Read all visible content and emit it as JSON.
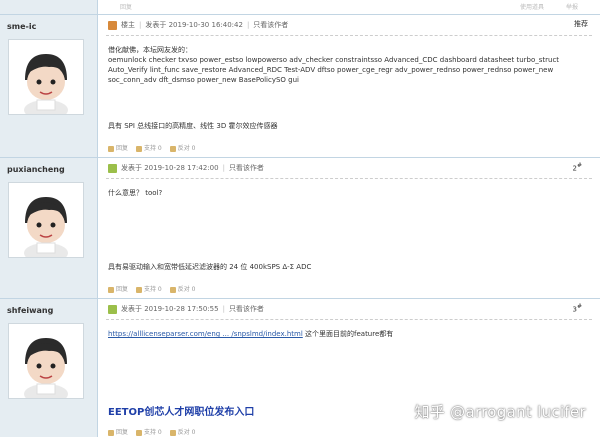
{
  "top_strip": {
    "left_action": "回复",
    "right_actions": [
      "使用道具",
      "举报"
    ]
  },
  "posts": [
    {
      "username": "sme-ic",
      "badge": "楼主",
      "posted": "发表于 2019-10-30 16:40:42",
      "author_only": "只看该作者",
      "floor_label": "推荐",
      "lines": [
        "借化献佛，本坛网友发的：",
        "oemunlock checker txvso power_estso lowpowerso adv_checker constraintsso Advanced_CDC dashboard datasheet turbo_struct",
        "Auto_Verify lint_func save_restore Advanced_RDC Test-ADV dftso power_cge_regr adv_power_rednso    power_rednso power_new",
        "soc_conn_adv dft_dsmso power_new BasePolicySO gui"
      ],
      "signature": "具有 SPI 总线接口的高精度、线性 3D 霍尔效应传感器",
      "actions": [
        "回复",
        "支持 0",
        "反对 0"
      ]
    },
    {
      "username": "puxiancheng",
      "posted": "发表于 2019-10-28 17:42:00",
      "author_only": "只看该作者",
      "floor_num": "2",
      "floor_sup": "#",
      "lines": [
        "什么意思？ tool?"
      ],
      "signature": "具有易驱动输入和宽带低延迟滤波器的 24 位 400kSPS Δ-Σ ADC",
      "actions": [
        "回复",
        "支持 0",
        "反对 0"
      ]
    },
    {
      "username": "shfeiwang",
      "posted": "发表于 2019-10-28 17:50:55",
      "author_only": "只看该作者",
      "floor_num": "3",
      "floor_sup": "#",
      "link_text": "https://alllicenseparser.com/eng ... /snpslmd/index.html",
      "after_link": " 这个里面目前的feature都有",
      "banner": "EETOP创芯人才网职位发布入口",
      "actions": [
        "回复",
        "支持 0",
        "反对 0"
      ]
    }
  ],
  "watermark": "知乎 @arrogant lucifer",
  "colors": {
    "sidebar": "#e5edf2",
    "border": "#c2d5e3",
    "link": "#2a5aa8",
    "banner": "#1f3fa8"
  }
}
